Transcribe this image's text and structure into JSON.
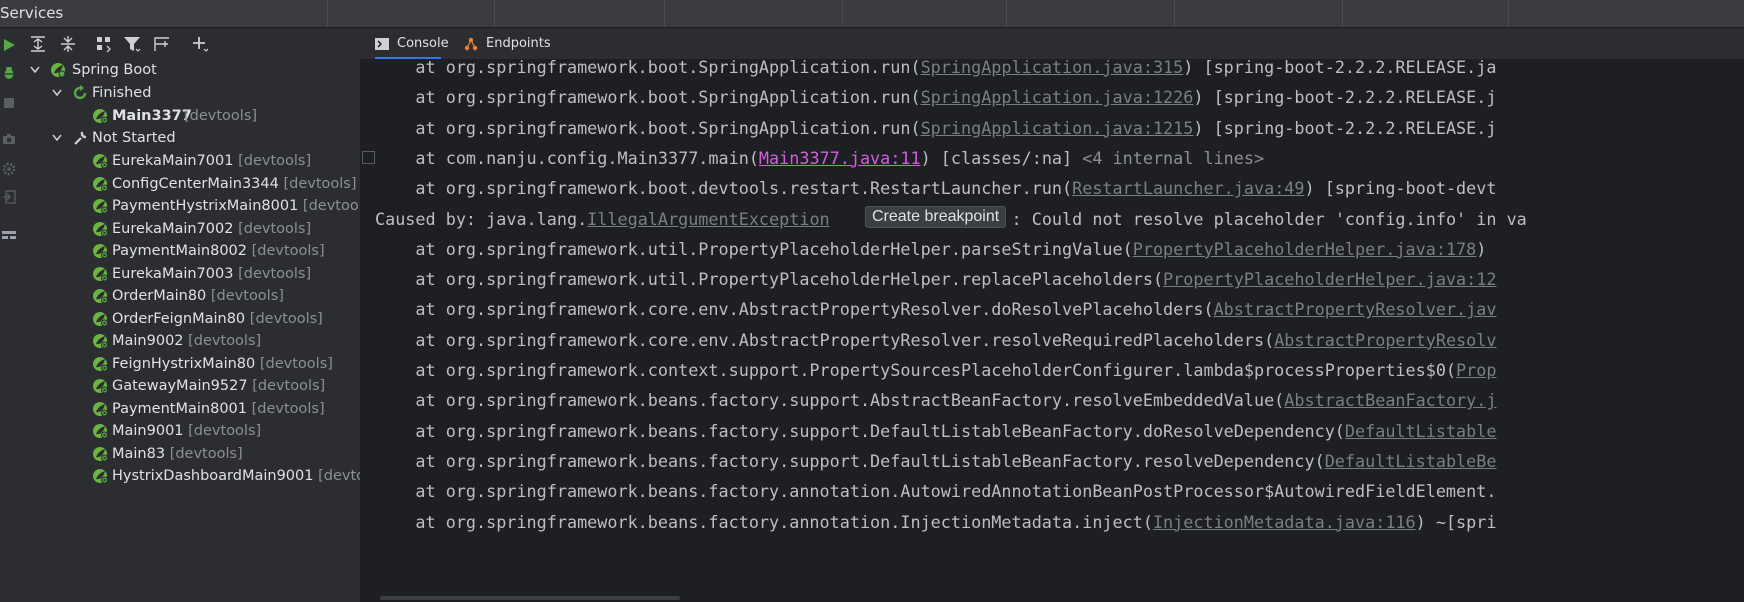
{
  "window": {
    "title": "Services"
  },
  "toolbar": {
    "buttons": [
      "run-icon",
      "expand-all-icon",
      "collapse-all-icon",
      "group-icon",
      "filter-icon",
      "new-group-icon",
      "add-icon"
    ]
  },
  "sidebar_left": {
    "icons": [
      "run-icon",
      "debug-icon",
      "stop-icon",
      "camera-icon",
      "settings-icon",
      "exit-icon",
      "layout-icon"
    ]
  },
  "tree": {
    "root": {
      "label": "Spring Boot"
    },
    "finished": {
      "label": "Finished"
    },
    "not_started": {
      "label": "Not Started"
    },
    "finished_items": [
      {
        "name": "Main3377",
        "tag": "[devtools]"
      }
    ],
    "items": [
      {
        "name": "EurekaMain7001",
        "tag": "[devtools]"
      },
      {
        "name": "ConfigCenterMain3344",
        "tag": "[devtools]"
      },
      {
        "name": "PaymentHystrixMain8001",
        "tag": "[devtools]"
      },
      {
        "name": "EurekaMain7002",
        "tag": "[devtools]"
      },
      {
        "name": "PaymentMain8002",
        "tag": "[devtools]"
      },
      {
        "name": "EurekaMain7003",
        "tag": "[devtools]"
      },
      {
        "name": "OrderMain80",
        "tag": "[devtools]"
      },
      {
        "name": "OrderFeignMain80",
        "tag": "[devtools]"
      },
      {
        "name": "Main9002",
        "tag": "[devtools]"
      },
      {
        "name": "FeignHystrixMain80",
        "tag": "[devtools]"
      },
      {
        "name": "GatewayMain9527",
        "tag": "[devtools]"
      },
      {
        "name": "PaymentMain8001",
        "tag": "[devtools]"
      },
      {
        "name": "Main9001",
        "tag": "[devtools]"
      },
      {
        "name": "Main83",
        "tag": "[devtools]"
      },
      {
        "name": "HystrixDashboardMain9001",
        "tag": "[devtools]"
      }
    ]
  },
  "tabs": [
    {
      "label": "Console",
      "icon": "console-icon"
    },
    {
      "label": "Endpoints",
      "icon": "endpoints-icon"
    }
  ],
  "tooltip": {
    "text": "Create breakpoint"
  },
  "console": {
    "lines": [
      {
        "pre": "    at org.springframework.boot.SpringApplication.run(",
        "link": "SpringApplication.java:315",
        "post": ") [spring-boot-2.2.2.RELEASE.ja"
      },
      {
        "pre": "    at org.springframework.boot.SpringApplication.run(",
        "link": "SpringApplication.java:1226",
        "post": ") [spring-boot-2.2.2.RELEASE.j"
      },
      {
        "pre": "    at org.springframework.boot.SpringApplication.run(",
        "link": "SpringApplication.java:1215",
        "post": ") [spring-boot-2.2.2.RELEASE.j"
      },
      {
        "pre": "    at com.nanju.config.Main3377.main(",
        "link": "Main3377.java:11",
        "post": ") [classes/:na] ",
        "extra": "<4 internal lines>"
      },
      {
        "pre": "    at org.springframework.boot.devtools.restart.RestartLauncher.run(",
        "link": "RestartLauncher.java:49",
        "post": ") [spring-boot-devt"
      },
      {
        "pre": "Caused by: java.lang.",
        "link": "IllegalArgumentException",
        "post": "                  : Could not resolve placeholder 'config.info' in va"
      },
      {
        "pre": "    at org.springframework.util.PropertyPlaceholderHelper.parseStringValue(",
        "link": "PropertyPlaceholderHelper.java:178",
        "post": ")"
      },
      {
        "pre": "    at org.springframework.util.PropertyPlaceholderHelper.replacePlaceholders(",
        "link": "PropertyPlaceholderHelper.java:12",
        "post": ""
      },
      {
        "pre": "    at org.springframework.core.env.AbstractPropertyResolver.doResolvePlaceholders(",
        "link": "AbstractPropertyResolver.jav",
        "post": ""
      },
      {
        "pre": "    at org.springframework.core.env.AbstractPropertyResolver.resolveRequiredPlaceholders(",
        "link": "AbstractPropertyResolv",
        "post": ""
      },
      {
        "pre": "    at org.springframework.context.support.PropertySourcesPlaceholderConfigurer.lambda$processProperties$0(",
        "link": "Prop",
        "post": ""
      },
      {
        "pre": "    at org.springframework.beans.factory.support.AbstractBeanFactory.resolveEmbeddedValue(",
        "link": "AbstractBeanFactory.j",
        "post": ""
      },
      {
        "pre": "    at org.springframework.beans.factory.support.DefaultListableBeanFactory.doResolveDependency(",
        "link": "DefaultListable",
        "post": ""
      },
      {
        "pre": "    at org.springframework.beans.factory.support.DefaultListableBeanFactory.resolveDependency(",
        "link": "DefaultListableBe",
        "post": ""
      },
      {
        "pre": "    at org.springframework.beans.factory.annotation.AutowiredAnnotationBeanPostProcessor$AutowiredFieldElement.",
        "link": "",
        "post": ""
      },
      {
        "pre": "    at org.springframework.beans.factory.annotation.InjectionMetadata.inject(",
        "link": "InjectionMetadata.java:116",
        "post": ") ~[spri"
      }
    ]
  },
  "colors": {
    "accent": "#3574f0",
    "spring_green": "#6db33f",
    "link_active": "#d35ee0"
  }
}
